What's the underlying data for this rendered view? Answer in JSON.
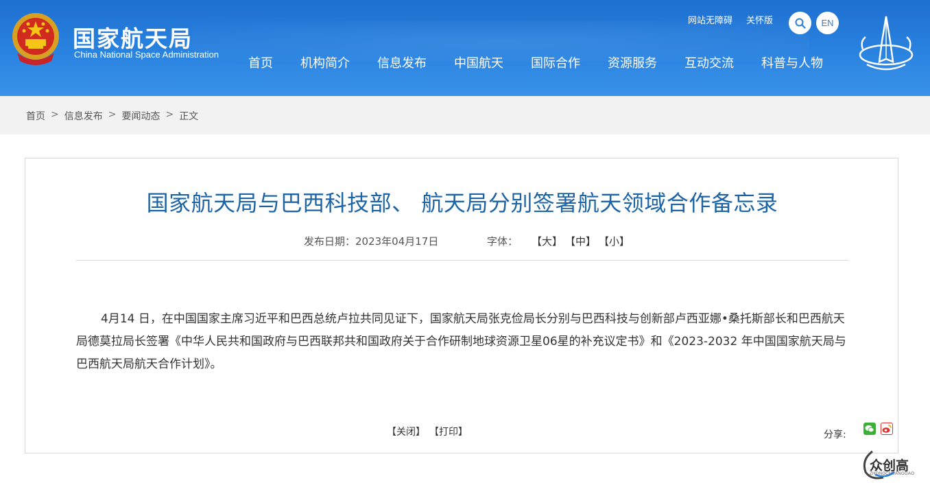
{
  "header": {
    "logo_cn": "国家航天局",
    "logo_en": "China National Space Administration",
    "top_links": [
      "网站无障碍",
      "关怀版"
    ],
    "en_label": "EN",
    "nav": [
      "首页",
      "机构简介",
      "信息发布",
      "中国航天",
      "国际合作",
      "资源服务",
      "互动交流",
      "科普与人物"
    ]
  },
  "breadcrumb": {
    "items": [
      "首页",
      "信息发布",
      "要闻动态",
      "正文"
    ],
    "sep": ">"
  },
  "article": {
    "title": "国家航天局与巴西科技部、 航天局分别签署航天领域合作备忘录",
    "date_label": "发布日期：2023年04月17日",
    "font_label": "字体：",
    "font_options": [
      "【大】",
      "【中】",
      "【小】"
    ],
    "body": "4月14 日，在中国国家主席习近平和巴西总统卢拉共同见证下，国家航天局张克俭局长分别与巴西科技与创新部卢西亚娜•桑托斯部长和巴西航天局德莫拉局长签署《中华人民共和国政府与巴西联邦共和国政府关于合作研制地球资源卫星06星的补充议定书》和《2023-2032 年中国国家航天局与巴西航天局航天合作计划》。",
    "close_label": "【关闭】",
    "print_label": "【打印】",
    "share_label": "分享:"
  },
  "watermark": {
    "text": "众创高",
    "sub": "ZHONGCHUANGGAO"
  },
  "colors": {
    "header_blue": "#2a7ed8",
    "title_blue": "#1d64a6",
    "crumb_bg": "#f2f2f2"
  },
  "icons": [
    "national-emblem-icon",
    "search-icon",
    "cnsa-logo-icon",
    "wechat-icon",
    "weibo-icon"
  ]
}
